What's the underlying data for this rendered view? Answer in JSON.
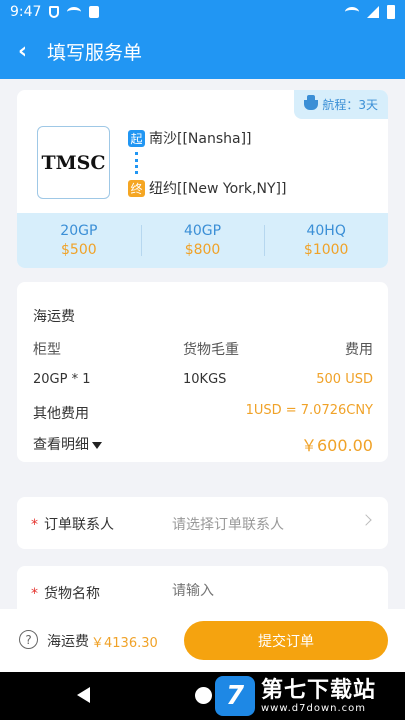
{
  "status_bar": {
    "time": "9:47"
  },
  "app_bar": {
    "title": "填写服务单"
  },
  "route": {
    "company_logo_text": "TMSC",
    "voyage_label": "航程：3天",
    "origin_tag": "起",
    "origin": "南沙[[Nansha]]",
    "destination_tag": "终",
    "destination": "纽约[[New York,NY]]",
    "prices": [
      {
        "type": "20GP",
        "price": "$500"
      },
      {
        "type": "40GP",
        "price": "$800"
      },
      {
        "type": "40HQ",
        "price": "$1000"
      }
    ]
  },
  "freight": {
    "title": "海运费",
    "headers": {
      "container": "柜型",
      "weight": "货物毛重",
      "fee": "费用"
    },
    "item": {
      "container": "20GP * 1",
      "weight": "10KGS",
      "fee": "500 USD"
    },
    "other_label": "其他费用",
    "exchange_rate": "1USD = 7.0726CNY",
    "detail_label": "查看明细",
    "total_cny": "￥600.00"
  },
  "form": {
    "contact": {
      "required_mark": "*",
      "label": "订单联系人",
      "placeholder": "请选择订单联系人"
    },
    "cargo": {
      "required_mark": "*",
      "label": "货物名称",
      "placeholder": "请输入"
    }
  },
  "bottom": {
    "help_icon": "?",
    "total_label": "海运费",
    "total_value": "￥4136.30",
    "submit_label": "提交订单"
  },
  "watermark": {
    "logo": "7",
    "title": "第七下载站",
    "url": "www.d7down.com"
  },
  "colors": {
    "primary": "#2196f3",
    "accent": "#f5a30f",
    "light_blue": "#d7eefb"
  }
}
